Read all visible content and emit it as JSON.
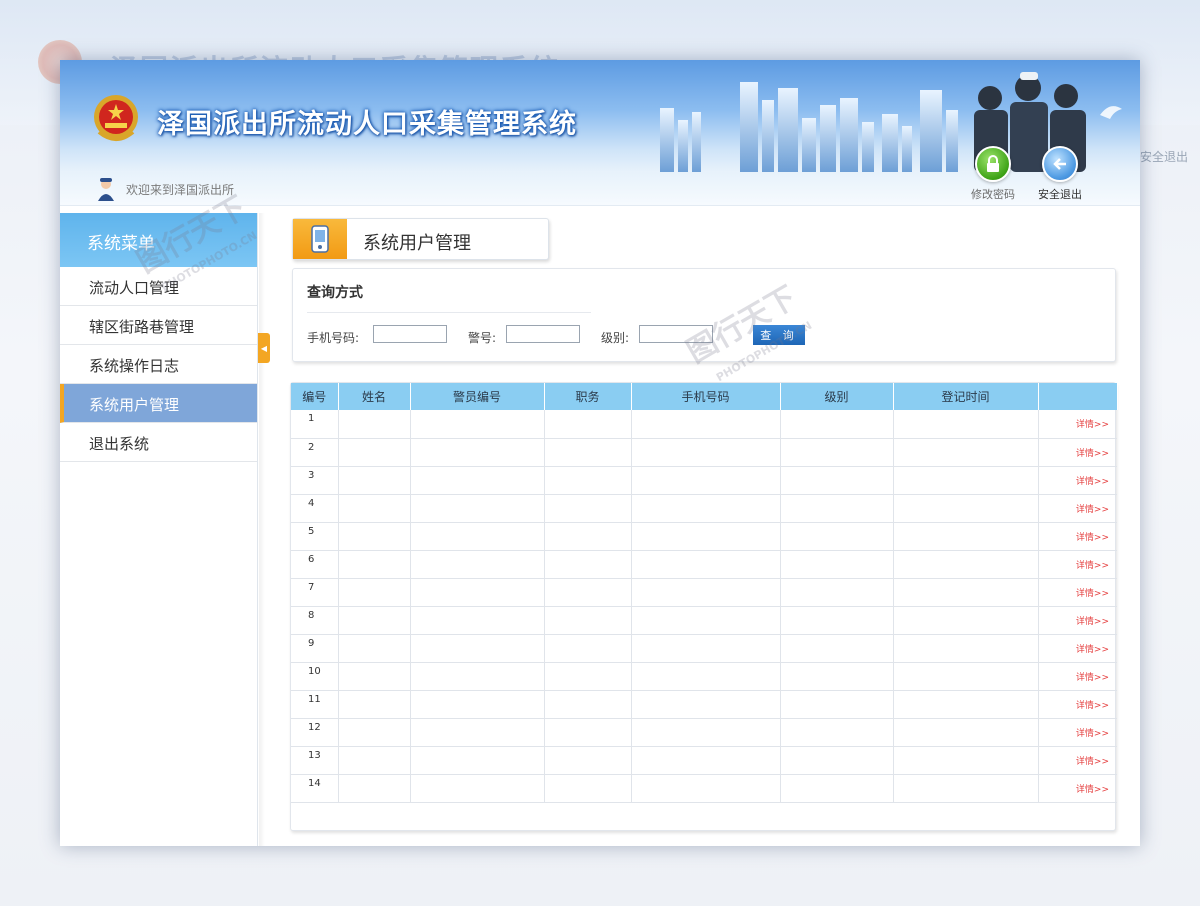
{
  "app": {
    "title": "泽国派出所流动人口采集管理系统",
    "welcome": "欢迎来到泽国派出所"
  },
  "header_buttons": {
    "change_password": "修改密码",
    "logout": "安全退出"
  },
  "sidebar": {
    "heading": "系统菜单",
    "items": [
      {
        "label": "流动人口管理",
        "active": false
      },
      {
        "label": "辖区街路巷管理",
        "active": false
      },
      {
        "label": "系统操作日志",
        "active": false
      },
      {
        "label": "系统用户管理",
        "active": true
      },
      {
        "label": "退出系统",
        "active": false
      }
    ]
  },
  "page": {
    "title": "系统用户管理"
  },
  "query": {
    "title": "查询方式",
    "phone_label": "手机号码:",
    "badge_label": "警号:",
    "level_label": "级别:",
    "phone_value": "",
    "badge_value": "",
    "level_value": "",
    "submit_label": "查 询"
  },
  "table": {
    "columns": [
      "编号",
      "姓名",
      "警员编号",
      "职务",
      "手机号码",
      "级别",
      "登记时间",
      ""
    ],
    "detail_label": "详情>>",
    "rows": [
      "1",
      "2",
      "3",
      "4",
      "5",
      "6",
      "7",
      "8",
      "9",
      "10",
      "11",
      "12",
      "13",
      "14"
    ]
  },
  "watermark": {
    "text": "图行天下",
    "sub": "PHOTOPHOTO.CN"
  },
  "colors": {
    "accent_orange": "#f3a623",
    "header_blue": "#5d9be2",
    "table_header": "#8acdf2",
    "active_menu": "#7fa6d9",
    "detail_red": "#e53f3f"
  }
}
